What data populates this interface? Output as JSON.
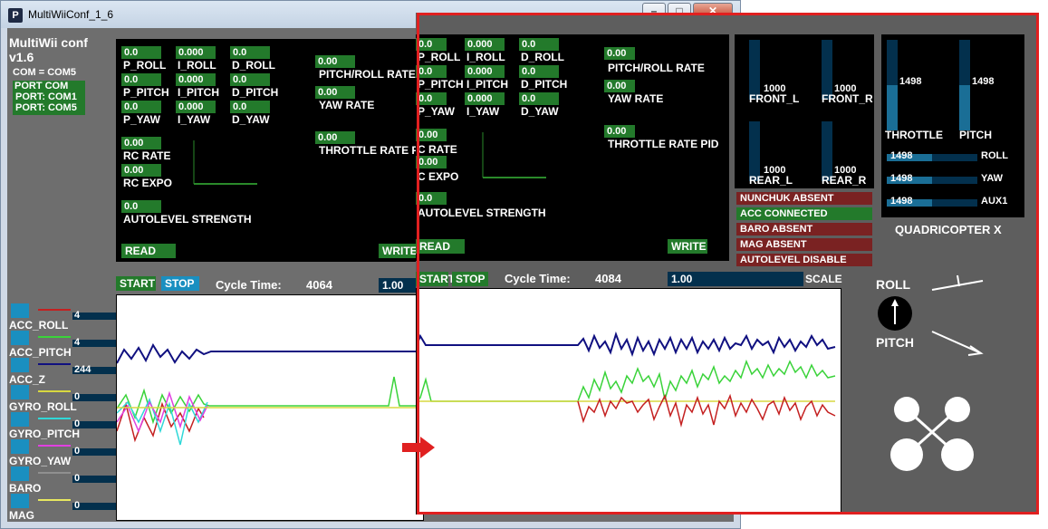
{
  "window1": {
    "title": "MultiWiiConf_1_6"
  },
  "window2": {
    "title": ""
  },
  "app": {
    "name": "MultiWii conf",
    "version": "v1.6",
    "com": "COM = COM5",
    "port_header": "PORT COM",
    "ports": [
      "PORT: COM1",
      "PORT: COM5"
    ]
  },
  "pid": {
    "p_roll": "0.0",
    "i_roll": "0.000",
    "d_roll": "0.0",
    "p_pitch": "0.0",
    "i_pitch": "0.000",
    "d_pitch": "0.0",
    "p_yaw": "0.0",
    "i_yaw": "0.000",
    "d_yaw": "0.0",
    "labels": {
      "p_roll": "P_ROLL",
      "i_roll": "I_ROLL",
      "d_roll": "D_ROLL",
      "p_pitch": "P_PITCH",
      "i_pitch": "I_PITCH",
      "d_pitch": "D_PITCH",
      "p_yaw": "P_YAW",
      "i_yaw": "I_YAW",
      "d_yaw": "D_YAW"
    },
    "labels_w2": {
      "p_roll": "P_ROLL",
      "i_roll": "I_ROLL",
      "d_roll": "D_ROLL",
      "p_pitch": "P_PITCH",
      "i_pitch": "I_PITCH",
      "d_pitch": "D_PITCH",
      "p_yaw": "P_YAW",
      "i_yaw": "I_YAW",
      "d_yaw": "D_YAW"
    }
  },
  "rates": {
    "pitch_roll_rate": "0.00",
    "pitch_roll_label": "PITCH/ROLL RATE",
    "yaw_rate": "0.00",
    "yaw_label": "YAW RATE",
    "throttle_pid": "0.00",
    "throttle_label_w1": "THROTTLE RATE PI",
    "throttle_label_w2": "THROTTLE RATE PID",
    "rc_rate": "0.00",
    "rc_rate_label": "RC RATE",
    "rc_rate_label_w2": "C RATE",
    "rc_expo": "0.00",
    "rc_expo_label": "RC EXPO",
    "rc_expo_label_w2": "C EXPO",
    "autolevel": "0.0",
    "autolevel_label": "AUTOLEVEL STRENGTH"
  },
  "buttons": {
    "read": "READ",
    "write": "WRITE",
    "start": "START",
    "stop": "STOP"
  },
  "cycle": {
    "label": "Cycle Time:",
    "value_w1": "4064",
    "value_w2": "4084",
    "scale_value": "1.00",
    "scale_label": "SCALE"
  },
  "sensors": [
    {
      "label": "ACC_ROLL",
      "value": "4",
      "color": "#c42020"
    },
    {
      "label": "ACC_PITCH",
      "value": "4",
      "color": "#3ad33a"
    },
    {
      "label": "ACC_Z",
      "value": "244",
      "color": "#101080"
    },
    {
      "label": "GYRO_ROLL",
      "value": "0",
      "color": "#d8d840"
    },
    {
      "label": "GYRO_PITCH",
      "value": "0",
      "color": "#30d8d8"
    },
    {
      "label": "GYRO_YAW",
      "value": "0",
      "color": "#e040e0"
    },
    {
      "label": "BARO",
      "value": "0",
      "color": "#909090"
    },
    {
      "label": "MAG",
      "value": "0",
      "color": "#e8e860"
    }
  ],
  "motors": {
    "front_l": "1000",
    "front_r": "1000",
    "rear_l": "1000",
    "rear_r": "1000",
    "labels": {
      "front_l": "FRONT_L",
      "front_r": "FRONT_R",
      "rear_l": "REAR_L",
      "rear_r": "REAR_R"
    }
  },
  "status": [
    {
      "text": "NUNCHUK ABSENT",
      "color": "#7a2222"
    },
    {
      "text": "ACC CONNECTED",
      "color": "#237a2b"
    },
    {
      "text": "BARO ABSENT",
      "color": "#7a2222"
    },
    {
      "text": "MAG ABSENT",
      "color": "#7a2222"
    },
    {
      "text": "AUTOLEVEL DISABLE",
      "color": "#7a2222"
    }
  ],
  "rc": {
    "throttle": "1498",
    "pitch": "1498",
    "throttle_label": "THROTTLE",
    "pitch_label": "PITCH",
    "roll": "1498",
    "yaw": "1498",
    "aux1": "1498",
    "roll_label": "ROLL",
    "yaw_label": "YAW",
    "aux1_label": "AUX1",
    "level": 0.5
  },
  "model": {
    "name": "QUADRICOPTER X",
    "roll_label": "ROLL",
    "pitch_label": "PITCH"
  }
}
